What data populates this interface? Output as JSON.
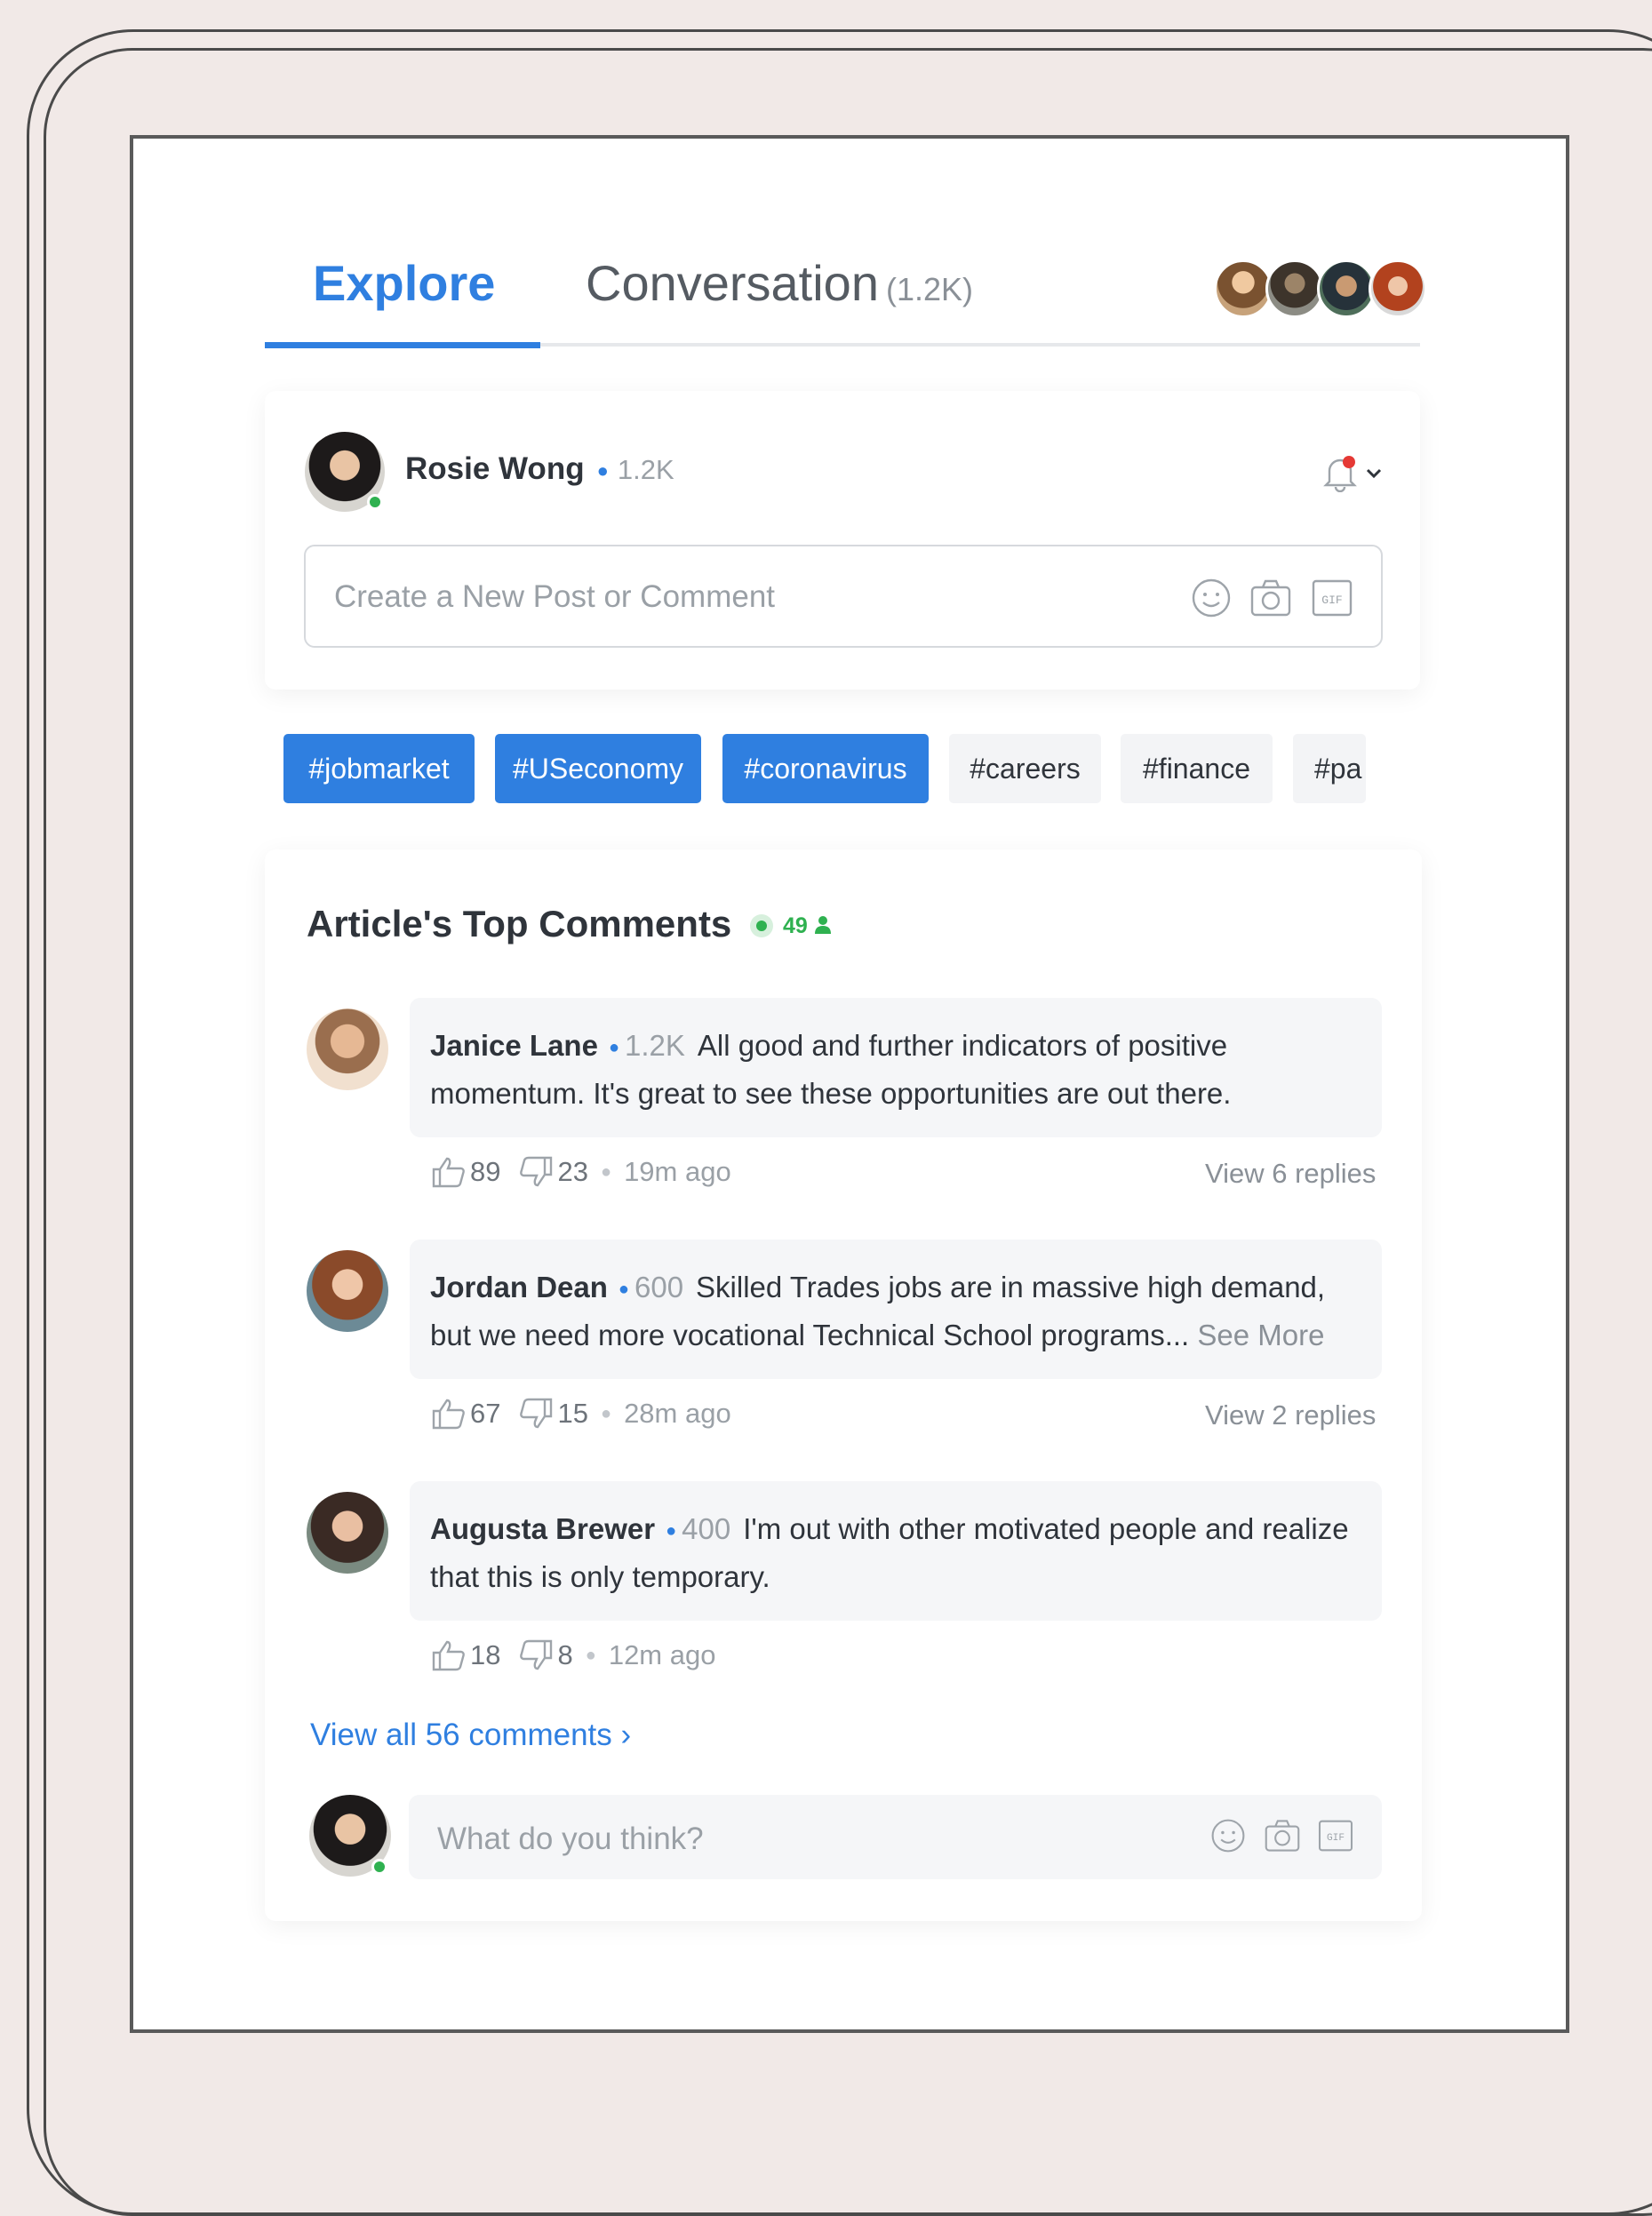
{
  "tabs": {
    "explore": "Explore",
    "conversation": "Conversation",
    "conversation_count": "(1.2K)"
  },
  "composer": {
    "user_name": "Rosie Wong",
    "user_score": "1.2K",
    "placeholder": "Create a New Post or Comment",
    "gif_label": "GIF"
  },
  "hashtags": [
    "#jobmarket",
    "#USeconomy",
    "#coronavirus",
    "#careers",
    "#finance",
    "#pa"
  ],
  "comments_section": {
    "title": "Article's Top Comments",
    "live_count": "49",
    "view_all": "View all 56 comments ›",
    "reply_placeholder": "What do you think?"
  },
  "comments": [
    {
      "name": "Janice Lane",
      "score": "1.2K",
      "text": "All good and further indicators of positive momentum. It's great to see these opportunities are out there.",
      "likes": "89",
      "dislikes": "23",
      "time": "19m ago",
      "replies": "View 6 replies"
    },
    {
      "name": "Jordan Dean",
      "score": "600",
      "text": "Skilled Trades jobs are in massive high demand, but we need more vocational Technical School programs...",
      "see_more": "See More",
      "likes": "67",
      "dislikes": "15",
      "time": "28m ago",
      "replies": "View 2 replies"
    },
    {
      "name": "Augusta Brewer",
      "score": "400",
      "text": "I'm out with other motivated people and realize that this is only temporary.",
      "likes": "18",
      "dislikes": "8",
      "time": "12m ago"
    }
  ],
  "colors": {
    "accent": "#2f7fe0",
    "online": "#2fb150",
    "notification": "#e53935",
    "background": "#f1e9e7"
  },
  "icons": {
    "notification": "bell-icon",
    "emoji": "smiley-icon",
    "camera": "camera-icon",
    "gif": "gif-icon",
    "like": "thumbs-up-icon",
    "dislike": "thumbs-down-icon"
  }
}
